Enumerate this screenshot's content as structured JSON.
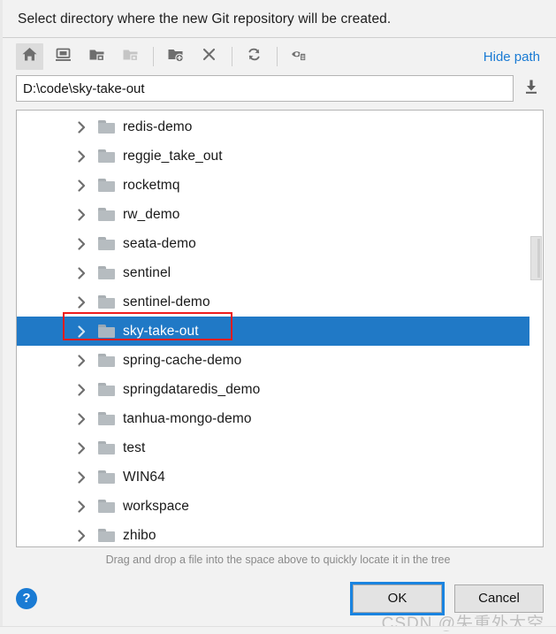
{
  "dialog": {
    "title": "Select directory where the new Git repository will be created.",
    "hint": "Drag and drop a file into the space above to quickly locate it in the tree",
    "watermark": "CSDN @失重外太空"
  },
  "toolbar": {
    "hide_path_label": "Hide path",
    "buttons": [
      {
        "name": "home-icon",
        "title": "Home"
      },
      {
        "name": "desktop-icon",
        "title": "Desktop"
      },
      {
        "name": "project-folder-icon",
        "title": "Project Directory"
      },
      {
        "name": "module-folder-icon",
        "title": "Module Directory"
      },
      {
        "name": "new-folder-icon",
        "title": "New Folder"
      },
      {
        "name": "delete-icon",
        "title": "Delete"
      },
      {
        "name": "refresh-icon",
        "title": "Refresh"
      },
      {
        "name": "show-hidden-files-icon",
        "title": "Show Hidden Files and Directories"
      }
    ]
  },
  "path": {
    "value": "D:\\code\\sky-take-out",
    "placeholder": ""
  },
  "tree": {
    "rows": [
      {
        "label": "redis-demo",
        "selected": false
      },
      {
        "label": "reggie_take_out",
        "selected": false
      },
      {
        "label": "rocketmq",
        "selected": false
      },
      {
        "label": "rw_demo",
        "selected": false
      },
      {
        "label": "seata-demo",
        "selected": false
      },
      {
        "label": "sentinel",
        "selected": false
      },
      {
        "label": "sentinel-demo",
        "selected": false
      },
      {
        "label": "sky-take-out",
        "selected": true
      },
      {
        "label": "spring-cache-demo",
        "selected": false
      },
      {
        "label": "springdataredis_demo",
        "selected": false
      },
      {
        "label": "tanhua-mongo-demo",
        "selected": false
      },
      {
        "label": "test",
        "selected": false
      },
      {
        "label": "WIN64",
        "selected": false
      },
      {
        "label": "workspace",
        "selected": false
      },
      {
        "label": "zhibo",
        "selected": false
      }
    ]
  },
  "footer": {
    "help_label": "?",
    "ok_label": "OK",
    "cancel_label": "Cancel"
  },
  "colors": {
    "selection_blue": "#2079c6",
    "link_blue": "#1a7bd4",
    "annotation_red": "#ee1c1c",
    "focus_ring": "#1a84e0",
    "folder_gray": "#b6bcc0",
    "dialog_bg": "#f2f2f2"
  }
}
